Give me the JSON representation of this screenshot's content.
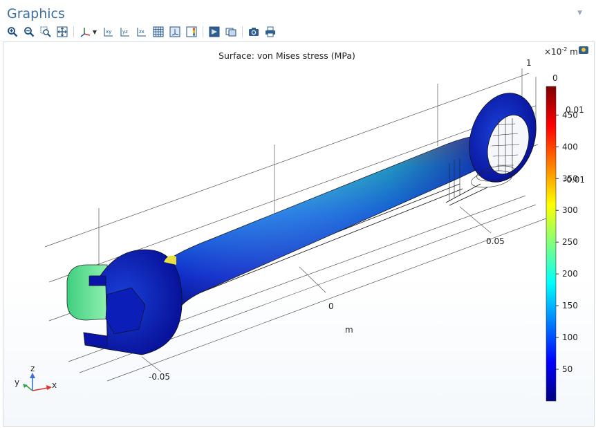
{
  "window": {
    "title": "Graphics"
  },
  "toolbar": {
    "buttons": [
      {
        "name": "zoom-in-icon"
      },
      {
        "name": "zoom-out-icon"
      },
      {
        "name": "zoom-box-icon"
      },
      {
        "name": "zoom-extents-icon"
      },
      {
        "name": "axis-orientation-icon"
      },
      {
        "name": "view-xy-icon",
        "label": "xy"
      },
      {
        "name": "view-yz-icon",
        "label": "yz"
      },
      {
        "name": "view-zx-icon",
        "label": "zx"
      },
      {
        "name": "grid-icon"
      },
      {
        "name": "axis-icon"
      },
      {
        "name": "color-legend-icon"
      },
      {
        "name": "transparency-icon"
      },
      {
        "name": "wireframe-icon"
      },
      {
        "name": "camera-icon"
      },
      {
        "name": "print-icon"
      }
    ]
  },
  "plot": {
    "title": "Surface: von Mises stress (MPa)",
    "unit_prefix": "×10",
    "unit_exponent": "-2",
    "unit_suffix": "m",
    "axis_labels": {
      "x_unit": "m",
      "tick_neg": "-0.05",
      "tick_zero": "0",
      "tick_pos": "0.05",
      "z_tick_1": "1",
      "z_tick_0": "0",
      "y_tick_p": "0.01",
      "y_tick_m": "-0.01"
    },
    "triad": {
      "x": "x",
      "y": "y",
      "z": "z"
    }
  },
  "colorbar": {
    "ticks": [
      "450",
      "400",
      "350",
      "300",
      "250",
      "200",
      "150",
      "100",
      "50"
    ],
    "values": [
      450,
      400,
      350,
      300,
      250,
      200,
      150,
      100,
      50
    ],
    "min": 0,
    "max": 495,
    "colors": [
      "#00007f",
      "#0000ff",
      "#007fff",
      "#00ffff",
      "#7fff7f",
      "#ffff00",
      "#ff7f00",
      "#ff0000",
      "#7f0000"
    ]
  }
}
